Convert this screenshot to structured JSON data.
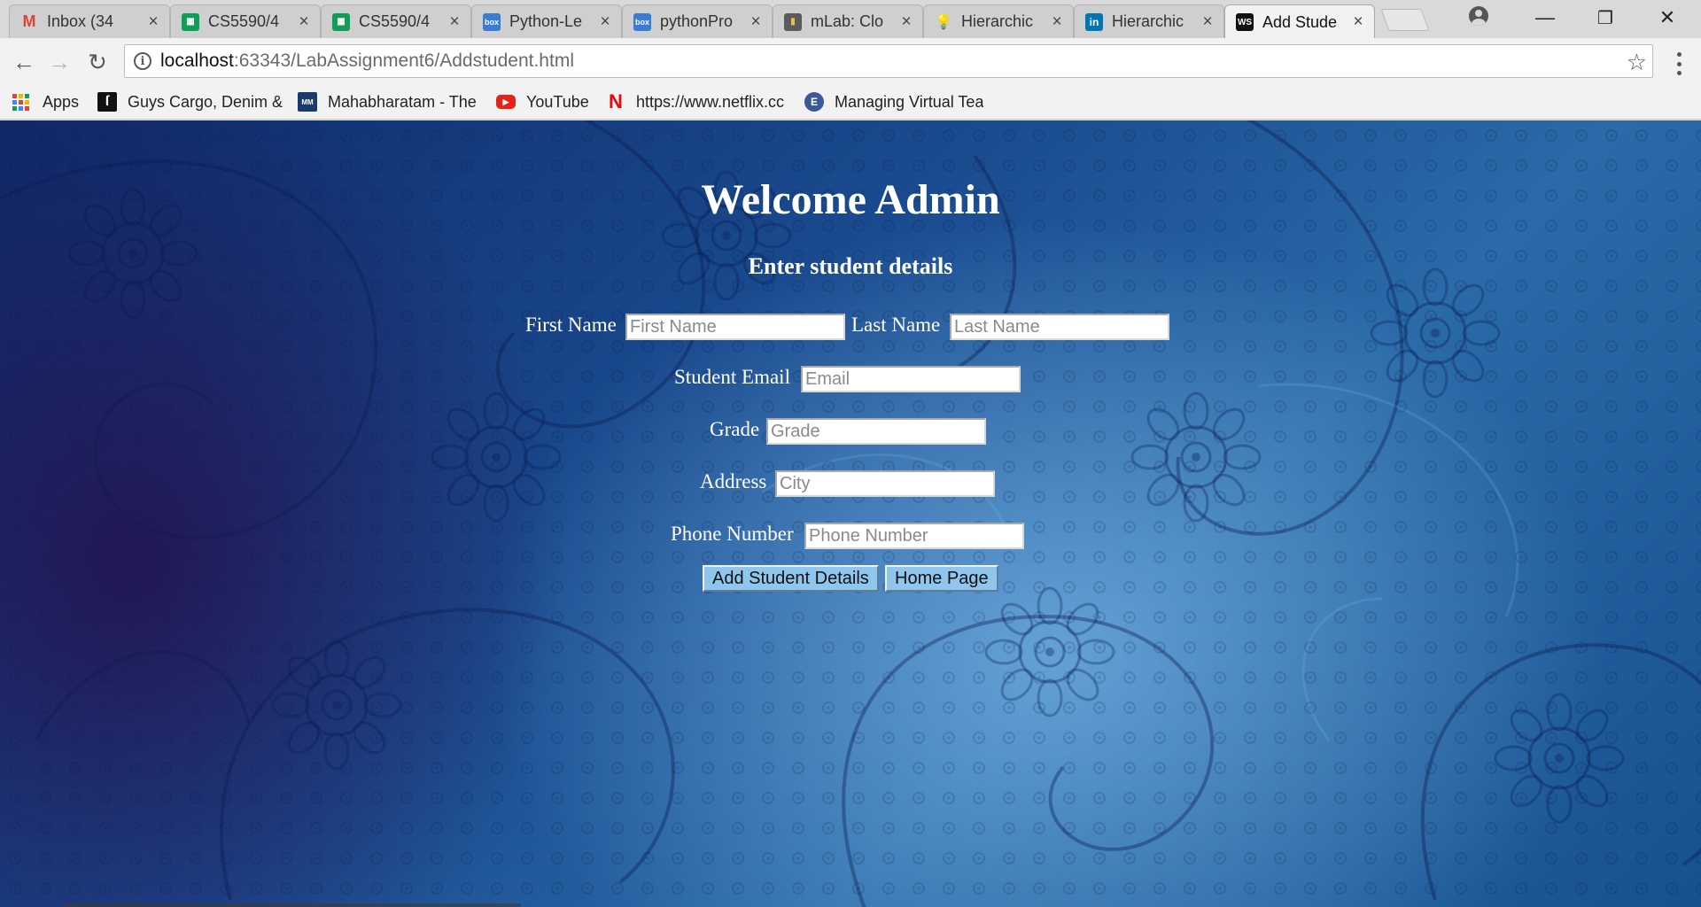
{
  "tabs": [
    {
      "title": "Inbox (34",
      "icon": "gmail-icon",
      "color": "#db4437",
      "glyph": "M"
    },
    {
      "title": "CS5590/4",
      "icon": "sheets-icon",
      "color": "#0f9d58",
      "glyph": "▦"
    },
    {
      "title": "CS5590/4",
      "icon": "sheets-icon",
      "color": "#0f9d58",
      "glyph": "▦"
    },
    {
      "title": "Python-Le",
      "icon": "box-icon",
      "color": "#3a7bd5",
      "glyph": "box"
    },
    {
      "title": "pythonPro",
      "icon": "box-icon",
      "color": "#3a7bd5",
      "glyph": "box"
    },
    {
      "title": "mLab: Clo",
      "icon": "mlab-icon",
      "color": "#5b5b5b",
      "glyph": "▮"
    },
    {
      "title": "Hierarchic",
      "icon": "lightbulb-icon",
      "color": "#a3c4a1",
      "glyph": "💡"
    },
    {
      "title": "Hierarchic",
      "icon": "linkedin-icon",
      "color": "#0077b5",
      "glyph": "in"
    },
    {
      "title": "Add Stude",
      "icon": "webstorm-icon",
      "color": "#111111",
      "glyph": "WS",
      "active": true
    }
  ],
  "window_controls": {
    "minimize": "—",
    "restore": "❐",
    "close": "✕"
  },
  "address": {
    "host": "localhost",
    "rest": ":63343/LabAssignment6/Addstudent.html"
  },
  "nav": {
    "back": "←",
    "forward": "→",
    "reload": "↻",
    "star": "☆"
  },
  "bookmarks": [
    {
      "label": "Apps",
      "icon": "apps-grid-icon"
    },
    {
      "label": "Guys Cargo, Denim &",
      "icon": "guys-cargo-icon",
      "color": "#111111",
      "glyph": "ſ"
    },
    {
      "label": "Mahabharatam - The",
      "icon": "mahabharatam-icon",
      "color": "#1a3a6a",
      "glyph": "MM"
    },
    {
      "label": "YouTube",
      "icon": "youtube-icon",
      "color": "#e62117",
      "glyph": "▶"
    },
    {
      "label": "https://www.netflix.cc",
      "icon": "netflix-icon",
      "color": "#ffffff",
      "glyph": "N"
    },
    {
      "label": "Managing Virtual Tea",
      "icon": "managing-virtual-icon",
      "color": "#3b5998",
      "glyph": "E"
    }
  ],
  "page": {
    "title": "Welcome Admin",
    "subtitle": "Enter student details",
    "fields": {
      "first_name": {
        "label": "First Name",
        "placeholder": "First Name",
        "value": ""
      },
      "last_name": {
        "label": "Last Name",
        "placeholder": "Last Name",
        "value": ""
      },
      "email": {
        "label": "Student Email",
        "placeholder": "Email",
        "value": ""
      },
      "grade": {
        "label": "Grade",
        "placeholder": "Grade",
        "value": ""
      },
      "address": {
        "label": "Address",
        "placeholder": "City",
        "value": ""
      },
      "phone": {
        "label": "Phone Number",
        "placeholder": "Phone Number",
        "value": ""
      }
    },
    "buttons": {
      "add": "Add Student Details",
      "home": "Home Page"
    }
  }
}
